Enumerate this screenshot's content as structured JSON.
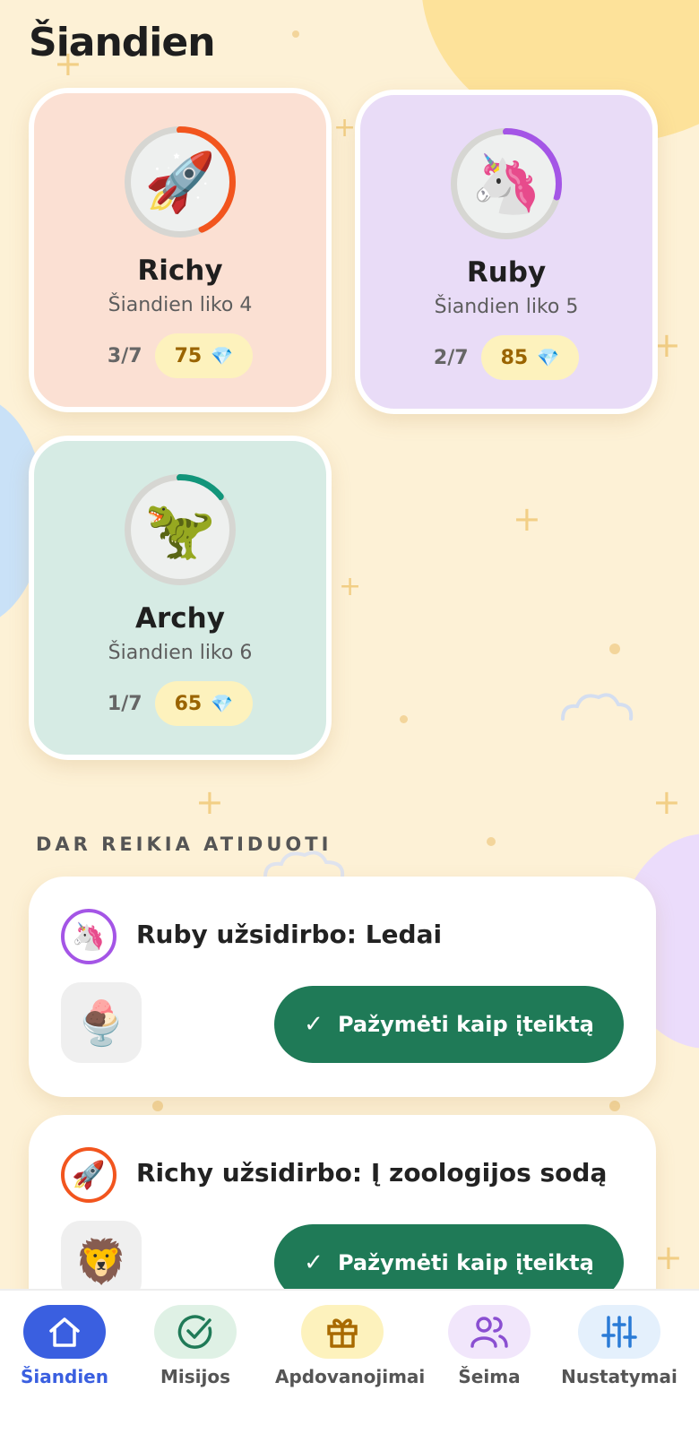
{
  "header": {
    "title": "Šiandien"
  },
  "kids": [
    {
      "name": "Richy",
      "subtitle": "Šiandien liko 4",
      "progress": "3/7",
      "gems": "75",
      "avatar": "🚀",
      "progress_fraction": 0.43,
      "color": "#fbe0d3",
      "ring_color": "#f2551e"
    },
    {
      "name": "Ruby",
      "subtitle": "Šiandien liko 5",
      "progress": "2/7",
      "gems": "85",
      "avatar": "🦄",
      "progress_fraction": 0.29,
      "color": "#e9dcf7",
      "ring_color": "#a455e6"
    },
    {
      "name": "Archy",
      "subtitle": "Šiandien liko 6",
      "progress": "1/7",
      "gems": "65",
      "avatar": "🦖",
      "progress_fraction": 0.14,
      "color": "#d6ebe4",
      "ring_color": "#12957a"
    }
  ],
  "gem_icon": "💎",
  "pending": {
    "title": "DAR REIKIA ATIDUOTI",
    "items": [
      {
        "title": "Ruby užsidirbo: Ledai",
        "avatar": "🦄",
        "avatar_color": "#a455e6",
        "image": "🍨",
        "button": "Pažymėti kaip įteiktą"
      },
      {
        "title": "Richy užsidirbo: Į zoologijos sodą",
        "avatar": "🚀",
        "avatar_color": "#f2551e",
        "image": "🦁",
        "button": "Pažymėti kaip įteiktą"
      }
    ]
  },
  "nav": [
    {
      "label": "Šiandien",
      "icon": "home-icon",
      "active": true,
      "color": "#3a5fe0",
      "bg": "#3a5fe0"
    },
    {
      "label": "Misijos",
      "icon": "check-circle-icon",
      "active": false,
      "color": "#1f7a57",
      "bg": "#dff1e5"
    },
    {
      "label": "Apdovanojimai",
      "icon": "gift-icon",
      "active": false,
      "color": "#a86a00",
      "bg": "#fdf2bd"
    },
    {
      "label": "Šeima",
      "icon": "users-icon",
      "active": false,
      "color": "#8a4fd1",
      "bg": "#f1e6fb"
    },
    {
      "label": "Nustatymai",
      "icon": "sliders-icon",
      "active": false,
      "color": "#2a7bd6",
      "bg": "#e4f0fc"
    }
  ]
}
